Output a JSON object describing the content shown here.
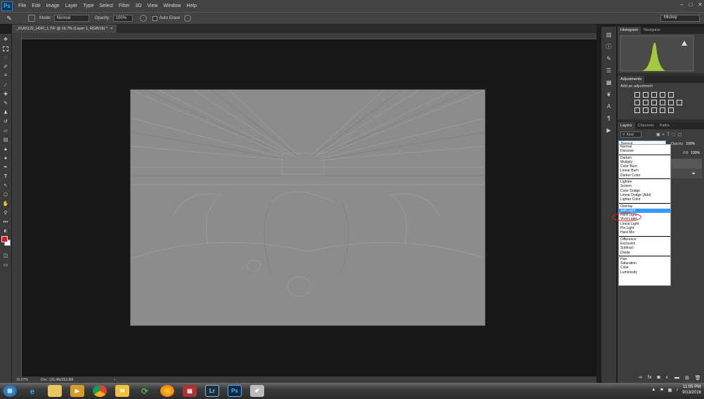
{
  "menubar": {
    "logo": "Ps",
    "items": [
      "File",
      "Edit",
      "Image",
      "Layer",
      "Type",
      "Select",
      "Filter",
      "3D",
      "View",
      "Window",
      "Help"
    ],
    "window_controls": [
      "–",
      "□",
      "✕"
    ]
  },
  "options": {
    "mode_label": "Mode:",
    "mode_value": "Normal",
    "opacity_label": "Opacity:",
    "opacity_value": "100%",
    "auto_erase_label": "Auto Erase",
    "workspace": "Mickey"
  },
  "document": {
    "tab_title": "_01A5122_HDR_1.TIF @ 16.7% (Layer 1, RGB/16) *",
    "zoom": "16.67%",
    "doc_info": "Doc: 126.4M/252.8M"
  },
  "panels": {
    "histogram_tabs": [
      "Histogram",
      "Navigator"
    ],
    "adjustments_title": "Adjustments",
    "add_adjustment": "Add an adjustment",
    "layers_tabs": [
      "Layers",
      "Channels",
      "Paths"
    ],
    "kind_label": "Kind",
    "blend_mode_value": "Normal",
    "opacity_label": "Opacity:",
    "opacity_value": "100%",
    "fill_label": "Fill:",
    "fill_value": "100%"
  },
  "blend_modes": {
    "groups": [
      [
        "Normal",
        "Dissolve"
      ],
      [
        "Darken",
        "Multiply",
        "Color Burn",
        "Linear Burn",
        "Darker Color"
      ],
      [
        "Lighten",
        "Screen",
        "Color Dodge",
        "Linear Dodge (Add)",
        "Lighter Color"
      ],
      [
        "Overlay",
        "Soft Light",
        "Hard Light",
        "Vivid Light",
        "Linear Light",
        "Pin Light",
        "Hard Mix"
      ],
      [
        "Difference",
        "Exclusion",
        "Subtract",
        "Divide"
      ],
      [
        "Hue",
        "Saturation",
        "Color",
        "Luminosity"
      ]
    ],
    "selected": "Soft Light"
  },
  "taskbar": {
    "icons": [
      "start-orb",
      "internet-explorer",
      "file-explorer",
      "media-player",
      "chrome",
      "outlook",
      "refresh-app",
      "firefox",
      "archive-app",
      "Lr",
      "Ps",
      "paint-app"
    ],
    "time": "11:05 PM",
    "date": "9/13/2016"
  },
  "colors": {
    "foreground": "#e8111a",
    "background": "#ffffff",
    "histogram_yellow": "#d7e33a"
  }
}
